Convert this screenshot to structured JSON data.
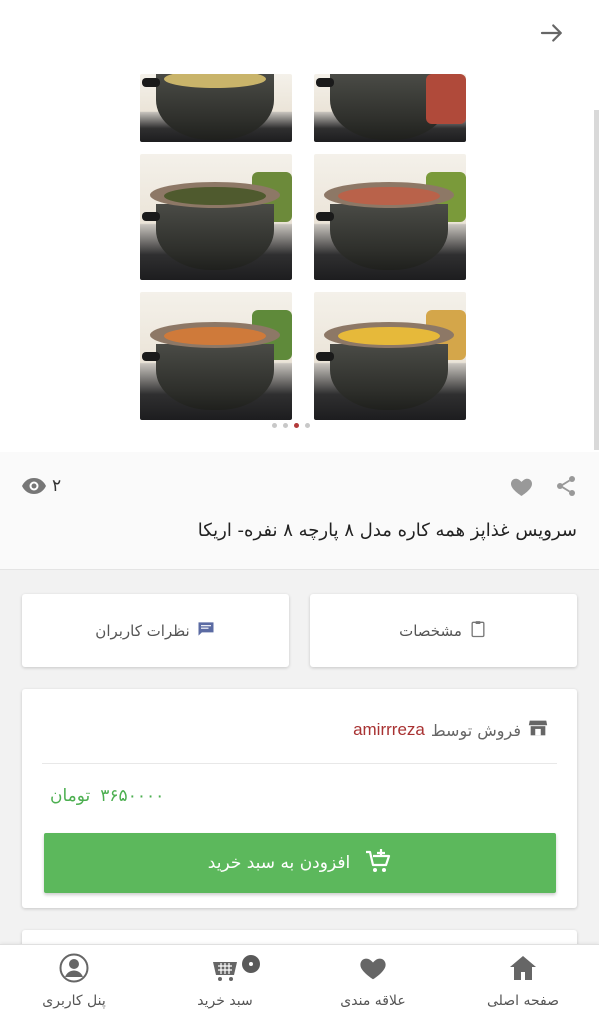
{
  "header": {
    "back_icon": "arrow-right-icon"
  },
  "gallery": {
    "image_count": 4,
    "active_index": 2,
    "tiles": [
      {
        "food": "rice"
      },
      {
        "food": "greens"
      },
      {
        "food": "pizza"
      },
      {
        "food": "nuggets"
      }
    ]
  },
  "product": {
    "views": "۲",
    "title": "سرویس غذاپز همه کاره مدل ۸ پارچه ۸ نفره- اریکا"
  },
  "tabs": {
    "specs_label": "مشخصات",
    "reviews_label": "نظرات کاربران"
  },
  "seller": {
    "sold_by_label": "فروش توسط",
    "name": "amirrreza"
  },
  "price": {
    "amount": "۳۶۵۰۰۰۰",
    "currency": "تومان"
  },
  "cart_button": {
    "label": "افزودن به سبد خرید"
  },
  "bottom_nav": {
    "home": "صفحه اصلی",
    "favorites": "علاقه مندی",
    "cart": "سبد خرید",
    "profile": "پنل کاربری"
  },
  "colors": {
    "accent_green": "#5cb85c",
    "seller_red": "#a83232",
    "active_dot": "#b23a3a"
  }
}
